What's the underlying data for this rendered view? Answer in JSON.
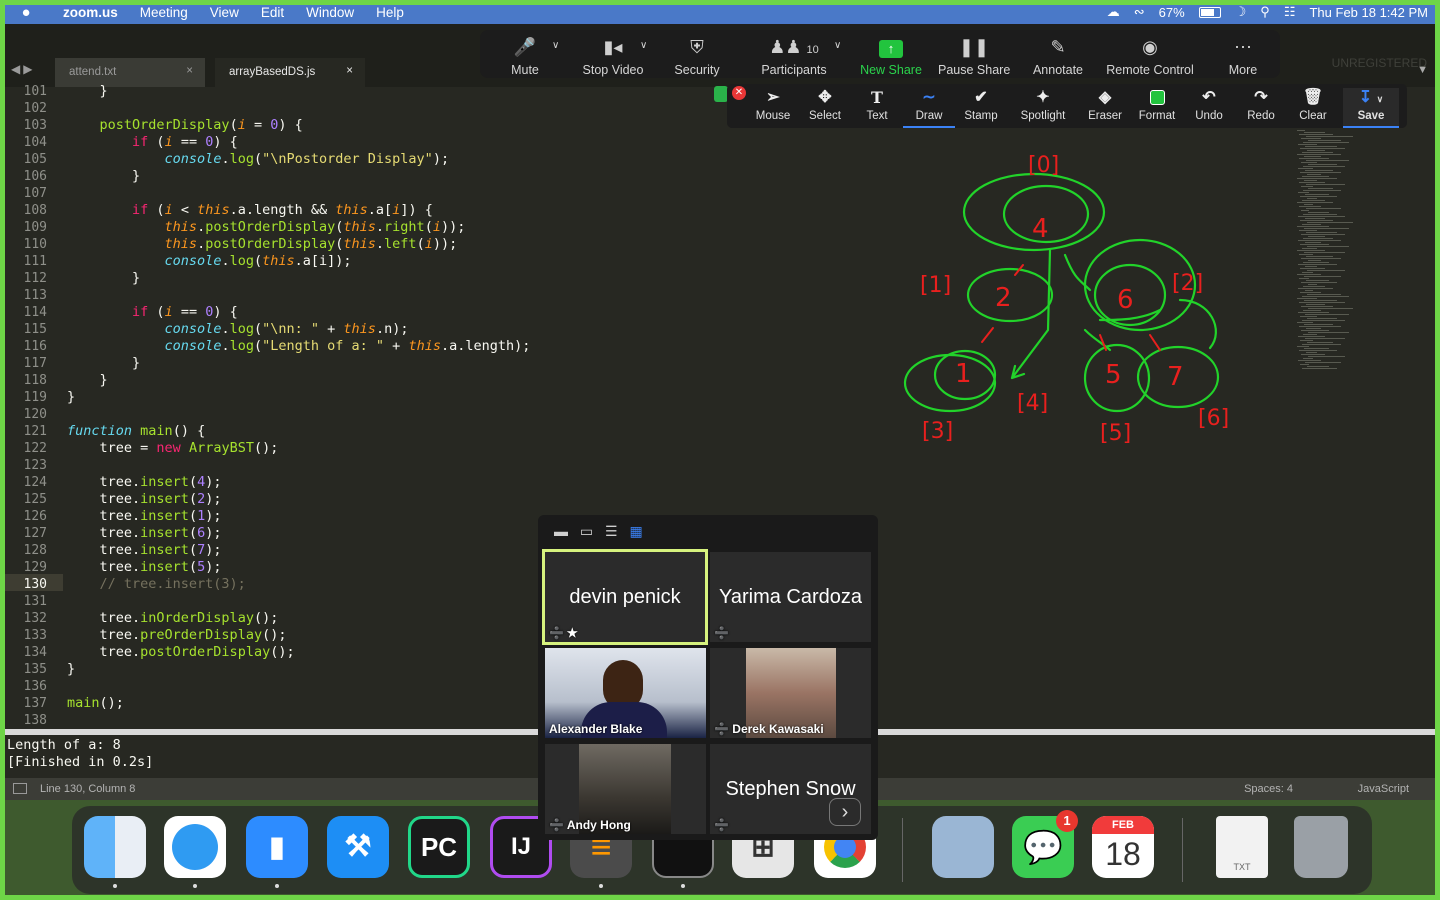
{
  "menubar": {
    "apple": "",
    "app": "zoom.us",
    "items": [
      "Meeting",
      "View",
      "Edit",
      "Window",
      "Help"
    ],
    "battery": "67%",
    "datetime": "Thu Feb 18  1:42 PM"
  },
  "editor": {
    "tabs": [
      {
        "label": "attend.txt",
        "close": "×"
      },
      {
        "label": "arrayBasedDS.js",
        "close": "×"
      }
    ],
    "unregistered": "UNREGISTERED",
    "first_line": 101,
    "lines": [
      "    }",
      "",
      "    postOrderDisplay(i = 0) {",
      "        if (i == 0) {",
      "            console.log(\"\\nPostorder Display\");",
      "        }",
      "",
      "        if (i < this.a.length && this.a[i]) {",
      "            this.postOrderDisplay(this.right(i));",
      "            this.postOrderDisplay(this.left(i));",
      "            console.log(this.a[i]);",
      "        }",
      "",
      "        if (i == 0) {",
      "            console.log(\"\\nn: \" + this.n);",
      "            console.log(\"Length of a: \" + this.a.length);",
      "        }",
      "    }",
      "}",
      "",
      "function main() {",
      "    tree = new ArrayBST();",
      "",
      "    tree.insert(4);",
      "    tree.insert(2);",
      "    tree.insert(1);",
      "    tree.insert(6);",
      "    tree.insert(7);",
      "    tree.insert(5);",
      "    // tree.insert(3);",
      "",
      "    tree.inOrderDisplay();",
      "    tree.preOrderDisplay();",
      "    tree.postOrderDisplay();",
      "}",
      "",
      "main();",
      ""
    ],
    "current_line": 130,
    "output": [
      "Length of a: 8",
      "[Finished in 0.2s]"
    ],
    "status": {
      "position": "Line 130, Column 8",
      "spaces": "Spaces: 4",
      "syntax": "JavaScript"
    }
  },
  "zoom_toolbar": {
    "items": [
      {
        "label": "Mute",
        "icon": "microphone-icon"
      },
      {
        "label": "Stop Video",
        "icon": "video-camera-icon"
      },
      {
        "label": "Security",
        "icon": "shield-icon"
      },
      {
        "label": "Participants",
        "icon": "participants-icon",
        "count": "10"
      },
      {
        "label": "New Share",
        "icon": "share-arrow-icon"
      },
      {
        "label": "Pause Share",
        "icon": "pause-icon"
      },
      {
        "label": "Annotate",
        "icon": "pencil-icon"
      },
      {
        "label": "Remote Control",
        "icon": "mouse-icon"
      },
      {
        "label": "More",
        "icon": "ellipsis-icon"
      }
    ]
  },
  "annotation_toolbar": {
    "items": [
      {
        "label": "Mouse",
        "icon": "cursor-icon"
      },
      {
        "label": "Select",
        "icon": "move-icon"
      },
      {
        "label": "Text",
        "icon": "text-icon"
      },
      {
        "label": "Draw",
        "icon": "squiggle-icon"
      },
      {
        "label": "Stamp",
        "icon": "checkmark-icon"
      },
      {
        "label": "Spotlight",
        "icon": "wand-icon"
      },
      {
        "label": "Eraser",
        "icon": "eraser-icon"
      },
      {
        "label": "Format",
        "icon": "color-square-icon"
      },
      {
        "label": "Undo",
        "icon": "undo-icon"
      },
      {
        "label": "Redo",
        "icon": "redo-icon"
      },
      {
        "label": "Clear",
        "icon": "trash-icon"
      },
      {
        "label": "Save",
        "icon": "save-icon"
      }
    ],
    "active": "Draw",
    "format_color": "#22c43e"
  },
  "annotations": {
    "labels": [
      "[0]",
      "[1]",
      "[2]",
      "[3]",
      "[4]",
      "[5]",
      "[6]"
    ],
    "node_values": [
      "4",
      "2",
      "6",
      "1",
      "5",
      "7"
    ],
    "ink_green": "#22d32a",
    "ink_red": "#e8201e"
  },
  "gallery": {
    "participants": [
      {
        "name": "devin penick",
        "video": false,
        "pinned": true
      },
      {
        "name": "Yarima Cardoza",
        "video": false
      },
      {
        "name": "Alexander Blake",
        "video": true
      },
      {
        "name": "Derek Kawasaki",
        "video": true
      },
      {
        "name": "Andy Hong",
        "video": true
      },
      {
        "name": "Stephen Snow",
        "video": false
      }
    ],
    "next": "›"
  },
  "dock": {
    "messages_badge": "1",
    "calendar_month": "FEB",
    "calendar_day": "18",
    "txt_label": "TXT"
  }
}
